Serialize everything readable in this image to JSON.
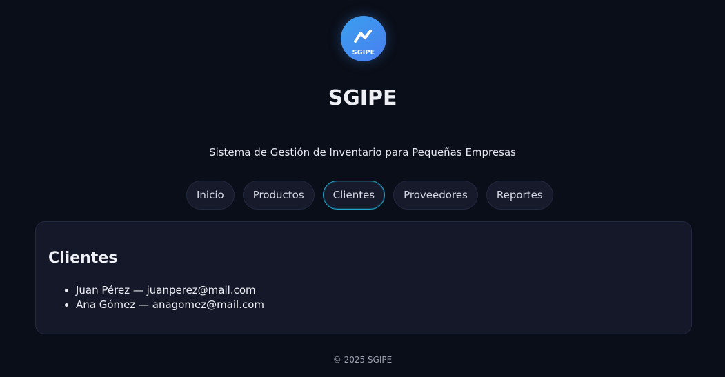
{
  "brand": {
    "logo_text": "SGIPE",
    "title": "SGIPE",
    "subtitle": "Sistema de Gestión de Inventario para Pequeñas Empresas",
    "accent_color": "#4a8ff0"
  },
  "nav": {
    "items": [
      {
        "label": "Inicio",
        "active": false
      },
      {
        "label": "Productos",
        "active": false
      },
      {
        "label": "Clientes",
        "active": true
      },
      {
        "label": "Proveedores",
        "active": false
      },
      {
        "label": "Reportes",
        "active": false
      }
    ],
    "active_color": "#1fa5c8"
  },
  "main": {
    "section_title": "Clientes",
    "clients": [
      {
        "text": "Juan Pérez — juanperez@mail.com"
      },
      {
        "text": "Ana Gómez — anagomez@mail.com"
      }
    ]
  },
  "footer": {
    "copyright": "© 2025 SGIPE"
  }
}
